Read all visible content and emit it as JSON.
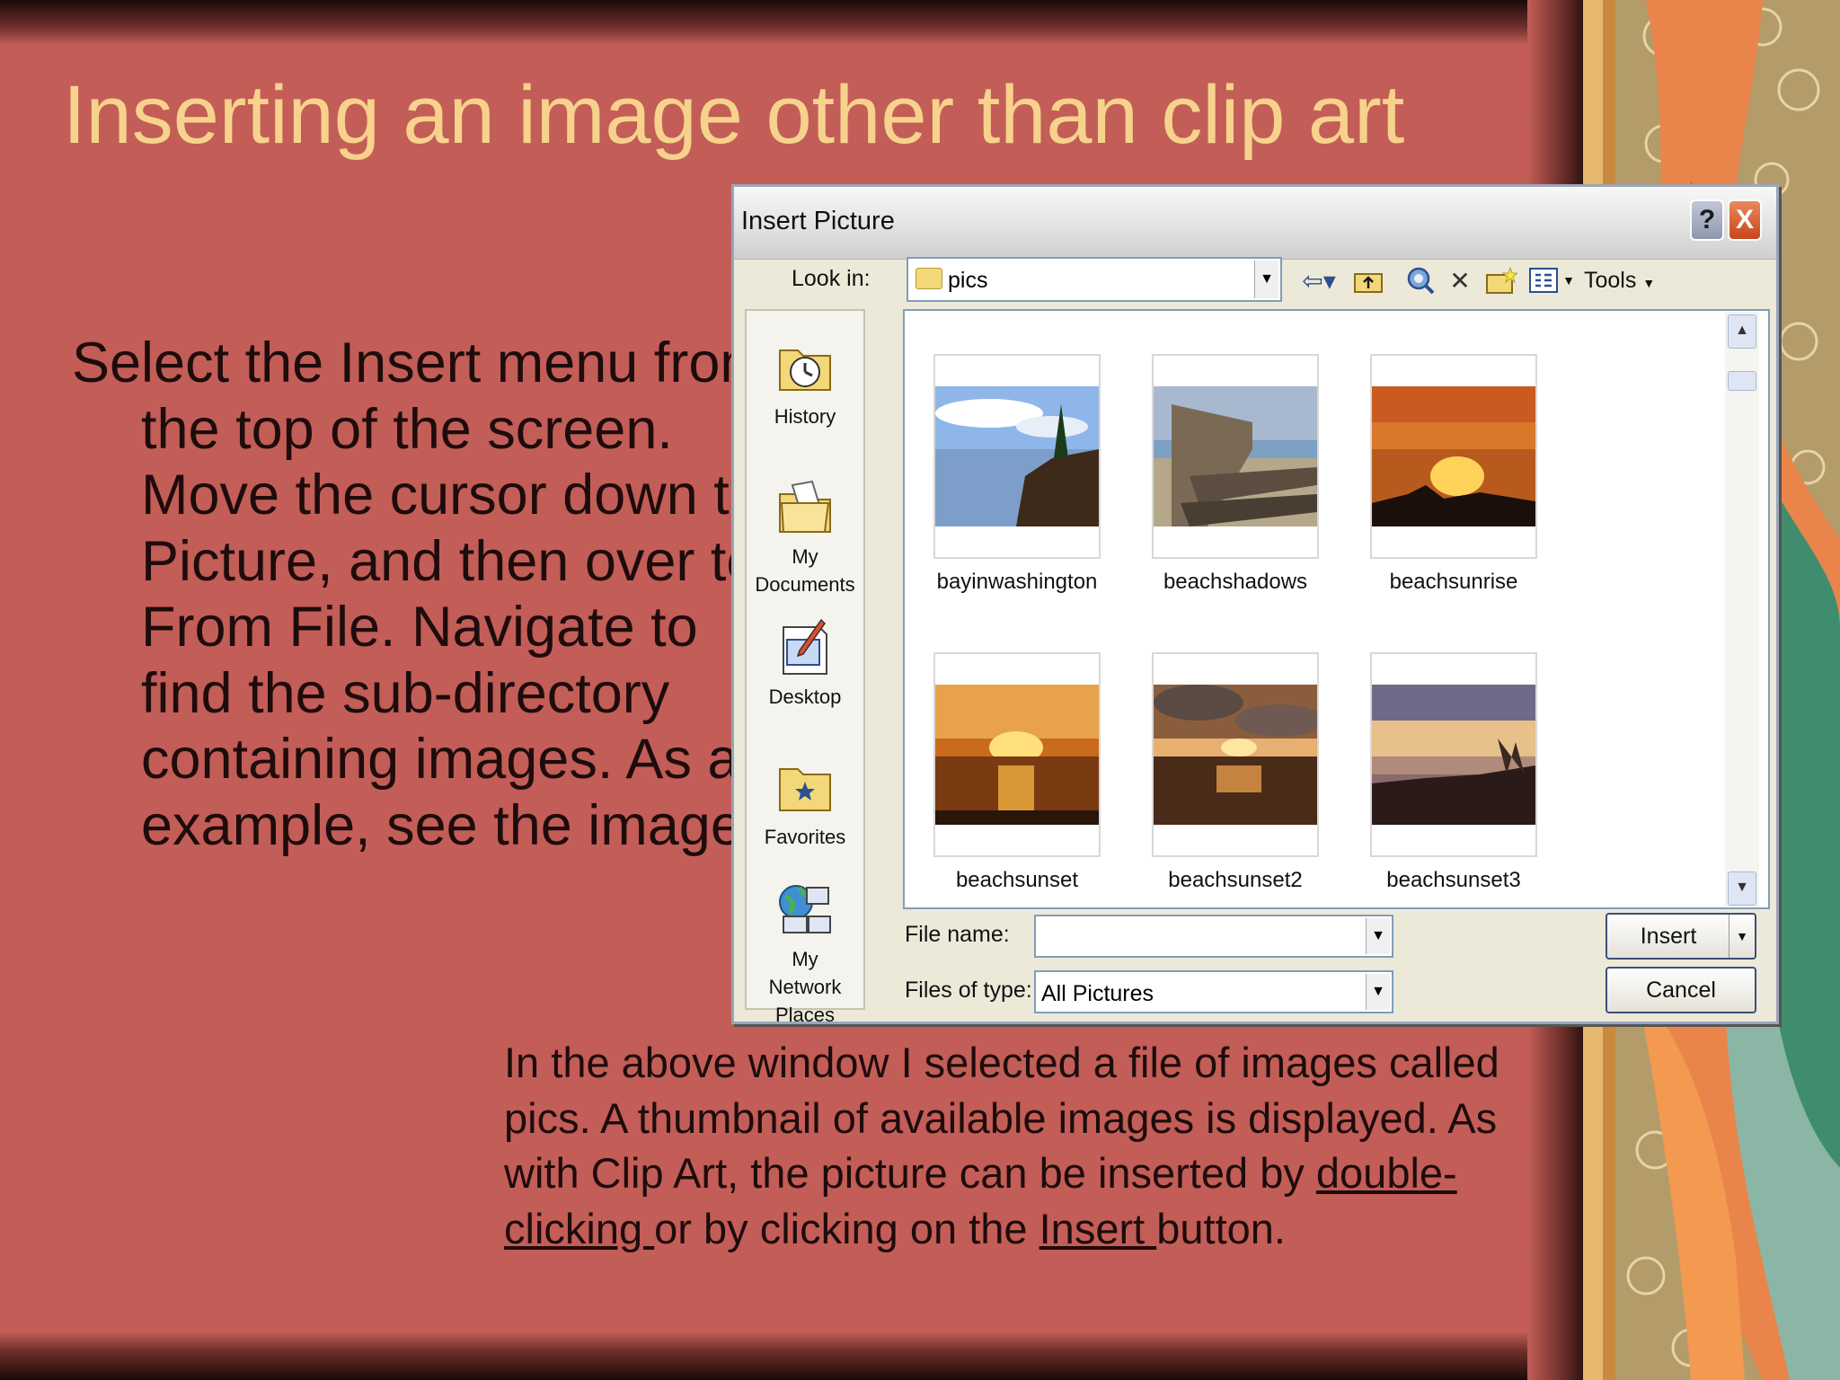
{
  "slide": {
    "title": "Inserting an image other than clip art",
    "body": "Select the Insert menu from the top of the screen. Move the cursor down to Picture, and then over to From File. Navigate to find the sub-directory containing images. As an example, see the image:",
    "caption": {
      "part1": "In the above window I selected a file of images called pics. A thumbnail of available images is displayed. As with Clip Art, the picture can be inserted by ",
      "link1": "double-clicking ",
      "part2": "or by clicking on the ",
      "link2": "Insert ",
      "part3": "button."
    }
  },
  "dialog": {
    "title": "Insert Picture",
    "help_label": "?",
    "close_label": "X",
    "look_in_label": "Look in:",
    "look_in_value": "pics",
    "tools_label": "Tools",
    "toolbar_icons": [
      "back-icon",
      "up-folder-icon",
      "search-web-icon",
      "delete-icon",
      "new-folder-icon",
      "views-icon"
    ],
    "places": [
      {
        "label": "History",
        "icon": "history-icon"
      },
      {
        "label": "My Documents",
        "icon": "my-documents-icon"
      },
      {
        "label": "Desktop",
        "icon": "desktop-icon"
      },
      {
        "label": "Favorites",
        "icon": "favorites-icon"
      },
      {
        "label": "My Network Places",
        "icon": "network-places-icon"
      }
    ],
    "files": [
      {
        "name": "bayinwashington"
      },
      {
        "name": "beachshadows"
      },
      {
        "name": "beachsunrise"
      },
      {
        "name": "beachsunset"
      },
      {
        "name": "beachsunset2"
      },
      {
        "name": "beachsunset3"
      }
    ],
    "file_name_label": "File name:",
    "file_name_value": "",
    "files_of_type_label": "Files of type:",
    "files_of_type_value": "All Pictures",
    "insert_label": "Insert",
    "cancel_label": "Cancel"
  },
  "colors": {
    "slide_bg": "#c35d57",
    "title_color": "#f7d28c",
    "text_color": "#1e0c0c",
    "dialog_bg": "#ece9d8",
    "close_button": "#d4532a"
  }
}
